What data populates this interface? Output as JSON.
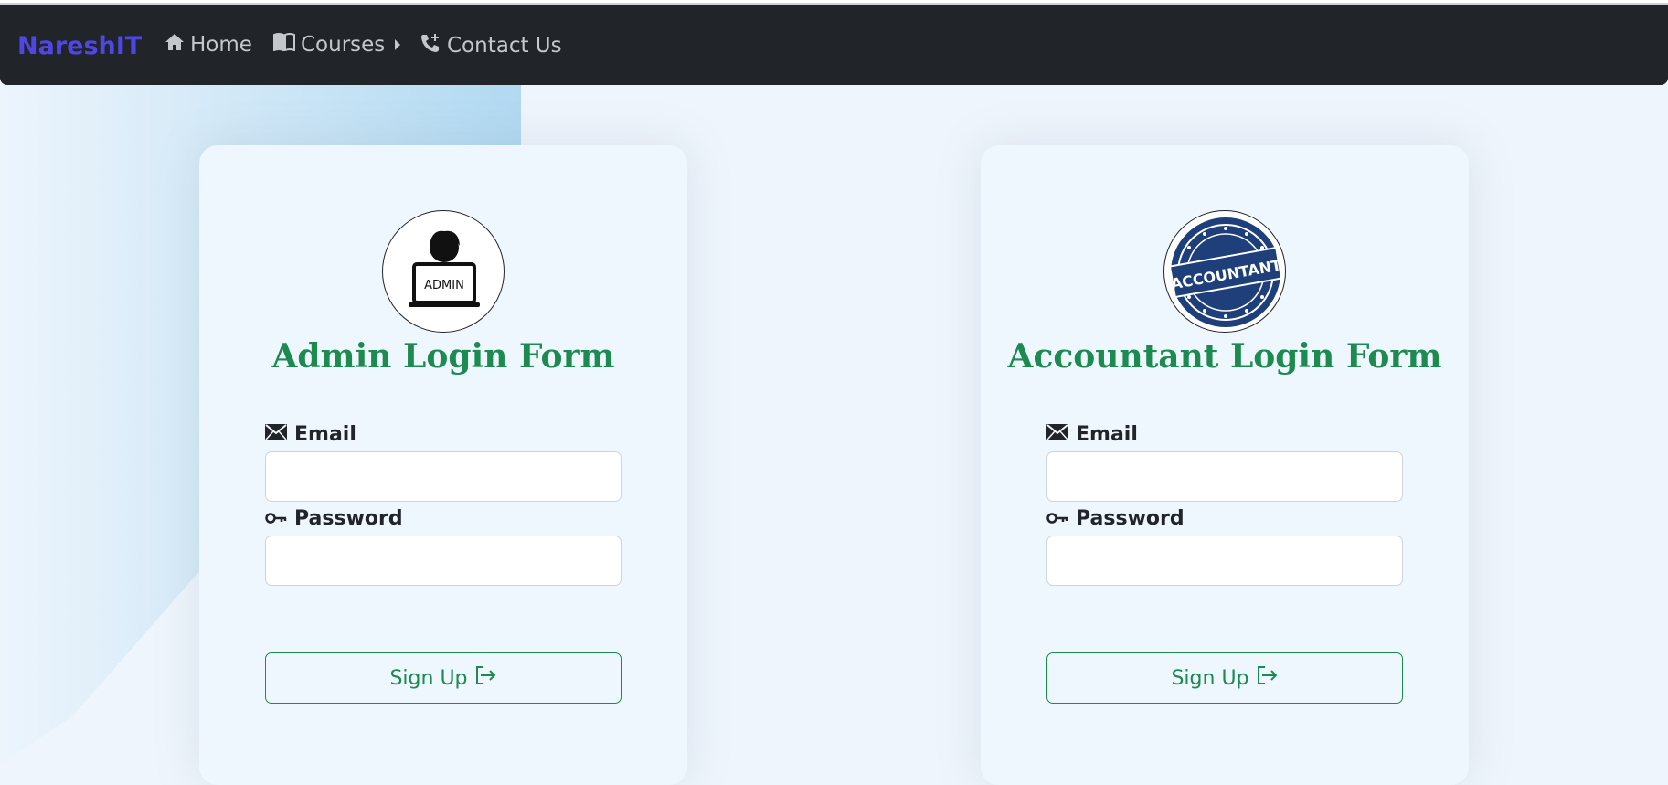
{
  "navbar": {
    "brand": "NareshIT",
    "items": [
      {
        "label": "Home",
        "icon": "home-icon"
      },
      {
        "label": "Courses",
        "icon": "book-icon"
      },
      {
        "label": "Contact Us",
        "icon": "phone-icon"
      }
    ]
  },
  "admin_form": {
    "title": "Admin Login Form",
    "avatar_text": "ADMIN",
    "email_label": "Email",
    "password_label": "Password",
    "email_value": "",
    "password_value": "",
    "button_label": "Sign Up"
  },
  "accountant_form": {
    "title": "Accountant Login Form",
    "avatar_text": "ACCOUNTANT",
    "email_label": "Email",
    "password_label": "Password",
    "email_value": "",
    "password_value": "",
    "button_label": "Sign Up"
  },
  "colors": {
    "brand": "#4f46e5",
    "navbar_bg": "#212529",
    "title_green": "#1d8a4f",
    "stamp_blue": "#1e3f7a"
  }
}
